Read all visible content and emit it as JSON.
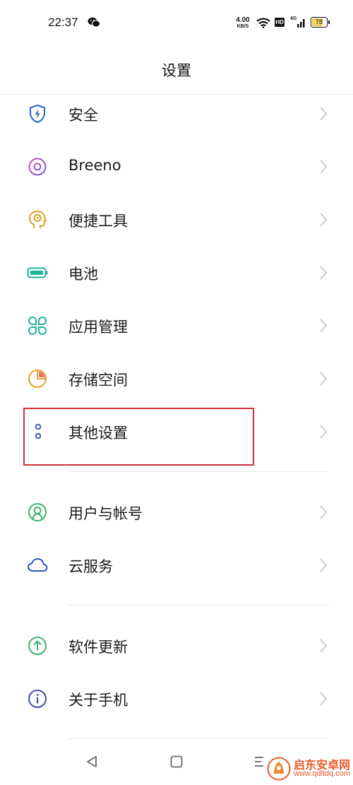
{
  "status_bar": {
    "time": "22:37",
    "speed_value": "4.00",
    "speed_unit": "KB/S",
    "hd": "HD",
    "signal_label": "4G",
    "battery": "78",
    "battery_level": 0.78,
    "icons": [
      "wechat-icon",
      "wifi-icon",
      "hd-icon",
      "signal-icon",
      "battery-icon"
    ]
  },
  "page": {
    "title": "设置"
  },
  "settings": {
    "items": [
      {
        "label": "安全",
        "icon": "shield-icon",
        "color": "#2e63c9"
      },
      {
        "label": "Breeno",
        "icon": "breeno-icon",
        "color": "#b44ad0"
      },
      {
        "label": "便捷工具",
        "icon": "convenience-tools-icon",
        "color": "#e0a22b"
      },
      {
        "label": "电池",
        "icon": "battery-icon",
        "color": "#1fb39b"
      },
      {
        "label": "应用管理",
        "icon": "app-management-icon",
        "color": "#1fb39b"
      },
      {
        "label": "存储空间",
        "icon": "storage-icon",
        "color": "#e9a12b"
      },
      {
        "label": "其他设置",
        "icon": "other-settings-icon",
        "color": "#3b4ea8"
      },
      {
        "label": "用户与帐号",
        "icon": "user-account-icon",
        "color": "#3db36b"
      },
      {
        "label": "云服务",
        "icon": "cloud-icon",
        "color": "#2b55c2"
      },
      {
        "label": "软件更新",
        "icon": "software-update-icon",
        "color": "#3db36b"
      },
      {
        "label": "关于手机",
        "icon": "about-phone-icon",
        "color": "#3b4ea8"
      }
    ]
  },
  "highlight_color": "#d0303a",
  "watermark": {
    "text": "启东安卓网",
    "url": "www.qdltdq.com"
  }
}
